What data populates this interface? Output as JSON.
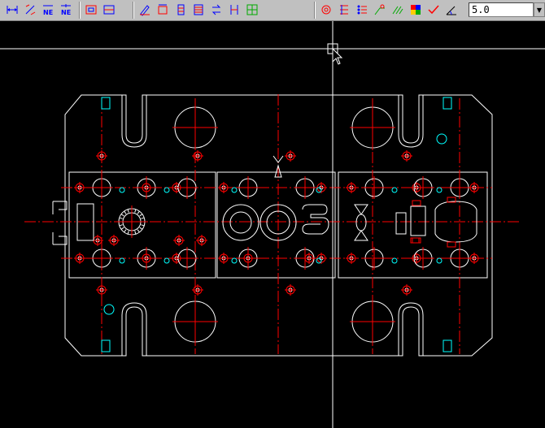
{
  "toolbar": {
    "groups": [
      [
        "dim-horizontal-icon",
        "dim-aligned-icon",
        "dim-baseline-ne-icon",
        "dim-continue-ne-icon"
      ],
      [
        "frame-box-icon",
        "frame-fit-icon"
      ],
      [
        "text-edit-icon",
        "dim-parallel-icon",
        "dim-stack-vertical-icon",
        "dim-stack-icon",
        "dim-swap-icon",
        "dim-double-icon",
        "dim-array-icon"
      ],
      [
        "hole-pattern-icon",
        "hole-table-icon",
        "hole-list-icon",
        "leader-line-icon",
        "multi-leader-icon",
        "color-table-icon",
        "check-mark-icon",
        "angle-tool-icon"
      ]
    ],
    "scale_value": "5.0"
  },
  "colors": {
    "toolbar_bg": "#c0c0c0",
    "canvas_bg": "#000000",
    "outline": "#ffffff",
    "centerline": "#ff0000",
    "aux": "#00ffff"
  }
}
